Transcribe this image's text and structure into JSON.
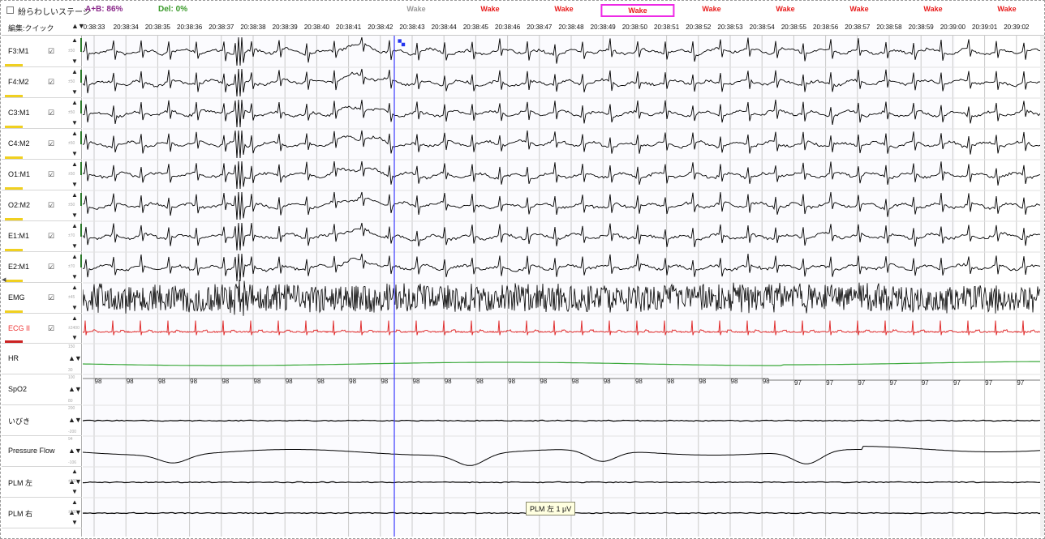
{
  "header": {
    "ambiguous_stage_label": "紛らわしいステージ",
    "ab_metric": "A+B: 86%",
    "del_metric": "Del: 0%",
    "edit_mode": "編集:クイック",
    "sort_arrows": "▲▼"
  },
  "stages": [
    {
      "label": "Wake",
      "state": "inactive",
      "selected": false
    },
    {
      "label": "Wake",
      "state": "scored",
      "selected": false
    },
    {
      "label": "Wake",
      "state": "scored",
      "selected": false
    },
    {
      "label": "Wake",
      "state": "scored",
      "selected": true
    },
    {
      "label": "Wake",
      "state": "scored",
      "selected": false
    },
    {
      "label": "Wake",
      "state": "scored",
      "selected": false
    },
    {
      "label": "Wake",
      "state": "scored",
      "selected": false
    },
    {
      "label": "Wake",
      "state": "scored",
      "selected": false
    },
    {
      "label": "Wake",
      "state": "scored",
      "selected": false
    }
  ],
  "time_ticks": [
    "0:38:33",
    "20:38:34",
    "20:38:35",
    "20:38:36",
    "20:38:37",
    "20:38:38",
    "20:38:39",
    "20:38:40",
    "20:38:41",
    "20:38:42",
    "20:38:43",
    "20:38:44",
    "20:38:45",
    "20:38:46",
    "20:38:47",
    "20:38:48",
    "20:38:49",
    "20:38:50",
    "20:38:51",
    "20:38:52",
    "20:38:53",
    "20:38:54",
    "20:38:55",
    "20:38:56",
    "20:38:57",
    "20:38:58",
    "20:38:59",
    "20:39:00",
    "20:39:01",
    "20:39:02"
  ],
  "channels": [
    {
      "name": "F3:M1",
      "checked": true,
      "scale": "±50",
      "kind": "eeg",
      "color": "#000000"
    },
    {
      "name": "F4:M2",
      "checked": true,
      "scale": "±50",
      "kind": "eeg",
      "color": "#000000"
    },
    {
      "name": "C3:M1",
      "checked": true,
      "scale": "±50",
      "kind": "eeg",
      "color": "#000000"
    },
    {
      "name": "C4:M2",
      "checked": true,
      "scale": "±50",
      "kind": "eeg",
      "color": "#000000"
    },
    {
      "name": "O1:M1",
      "checked": true,
      "scale": "±50",
      "kind": "eeg",
      "color": "#000000"
    },
    {
      "name": "O2:M2",
      "checked": true,
      "scale": "±50",
      "kind": "eeg",
      "color": "#000000"
    },
    {
      "name": "E1:M1",
      "checked": true,
      "scale": "±70",
      "kind": "eeg",
      "color": "#000000"
    },
    {
      "name": "E2:M1",
      "checked": true,
      "scale": "±70",
      "kind": "eeg",
      "color": "#000000"
    },
    {
      "name": "EMG",
      "checked": true,
      "scale": "±45",
      "kind": "emg",
      "color": "#000000"
    },
    {
      "name": "ECG II",
      "checked": true,
      "scale": "±2400",
      "kind": "ecg",
      "color": "#e03030"
    },
    {
      "name": "HR",
      "checked": false,
      "scale_top": "150",
      "scale_bottom": "30",
      "kind": "hr",
      "color": "#3aa83a"
    },
    {
      "name": "SpO2",
      "checked": false,
      "scale_top": "100",
      "scale_bottom": "80",
      "kind": "spo2",
      "color": "#555555"
    },
    {
      "name": "いびき",
      "checked": false,
      "scale_top": "200",
      "scale_bottom": "-200",
      "kind": "flat",
      "color": "#000000"
    },
    {
      "name": "Pressure Flow",
      "checked": false,
      "scale_top": "94",
      "scale_bottom": "-106",
      "kind": "flow",
      "color": "#000000"
    },
    {
      "name": "PLM 左",
      "checked": false,
      "scale": "±200",
      "kind": "flat",
      "color": "#000000"
    },
    {
      "name": "PLM 右",
      "checked": false,
      "scale": "±200",
      "kind": "flat",
      "color": "#000000"
    }
  ],
  "spo2_values": [
    "98",
    "98",
    "98",
    "98",
    "98",
    "98",
    "98",
    "98",
    "98",
    "98",
    "98",
    "98",
    "98",
    "98",
    "98",
    "98",
    "98",
    "98",
    "98",
    "98",
    "98",
    "98",
    "97",
    "97",
    "97",
    "97",
    "97",
    "97",
    "97",
    "97"
  ],
  "tooltip": "PLM 左 1 μV",
  "colors": {
    "stage_scored": "#e81c1c",
    "stage_inactive": "#9a9a9a",
    "selected_stage_border": "#ee2ae6",
    "cursor": "#3b3bff",
    "ecg": "#e03030",
    "hr": "#3aa83a"
  }
}
